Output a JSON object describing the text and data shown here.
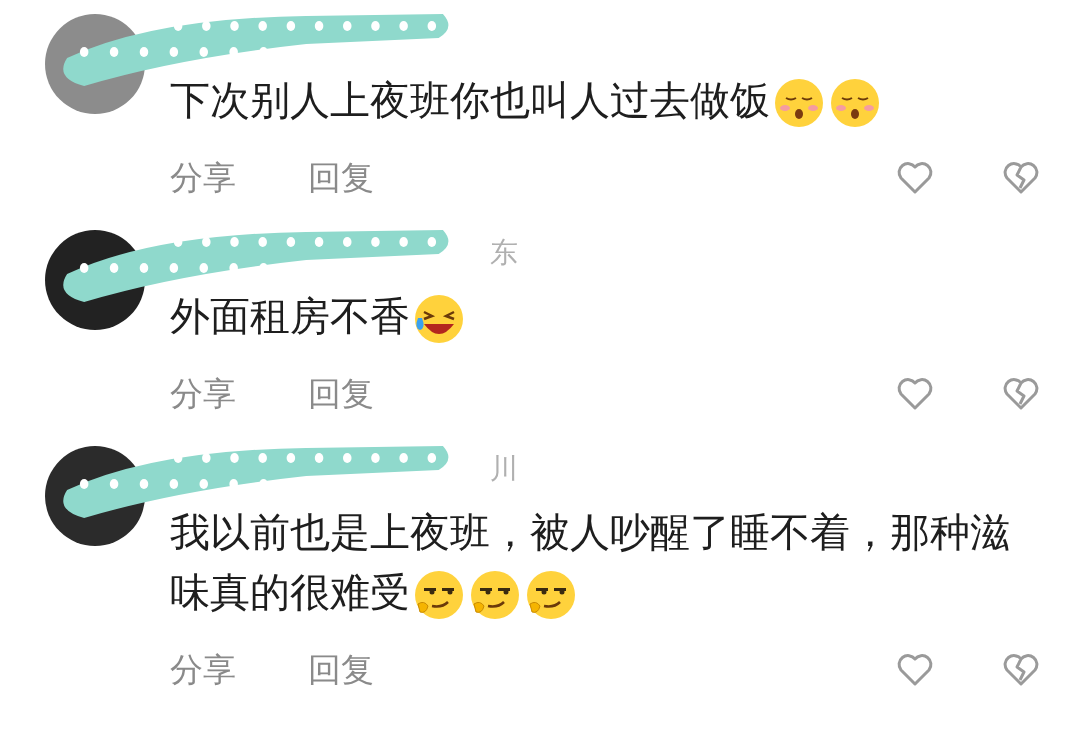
{
  "comments": [
    {
      "text_lines": [
        "下次别人上夜班你也叫人过去做饭"
      ],
      "emojis": [
        {
          "kind": "shush"
        },
        {
          "kind": "shush"
        }
      ],
      "actions": [
        "分享",
        "回复"
      ]
    },
    {
      "name_fragment": "东",
      "text_lines": [
        "外面租房不香"
      ],
      "emojis": [
        {
          "kind": "laugh-cry"
        }
      ],
      "actions": [
        "分享",
        "回复"
      ]
    },
    {
      "name_fragment": "川",
      "text_lines": [
        "我以前也是上夜班，被人吵醒了睡不着，那种滋",
        "味真的很难受"
      ],
      "emojis": [
        {
          "kind": "smirk"
        },
        {
          "kind": "smirk"
        },
        {
          "kind": "smirk"
        }
      ],
      "actions": [
        "分享",
        "回复"
      ]
    }
  ]
}
